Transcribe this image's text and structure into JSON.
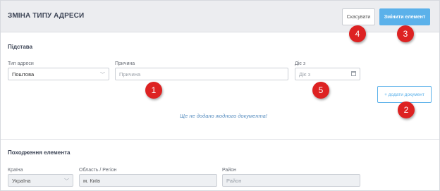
{
  "header": {
    "title": "ЗМІНА ТИПУ АДРЕСИ",
    "cancel_label": "Скасувати",
    "save_label": "Змінити елемент"
  },
  "basis": {
    "section_title": "Підстава",
    "address_type_label": "Тип адреси",
    "address_type_value": "Поштова",
    "reason_label": "Причина",
    "reason_placeholder": "Причина",
    "valid_from_label": "Діє з",
    "valid_from_placeholder": "Діє з",
    "add_document_label": "+ додати документ",
    "empty_message": "Ще не додано жодного документа!"
  },
  "origin": {
    "section_title": "Походження елемента",
    "country_label": "Країна",
    "country_value": "Україна",
    "region_label": "Область / Регіон",
    "region_value": "м. Київ",
    "district_label": "Район",
    "district_placeholder": "Район"
  },
  "callouts": [
    "1",
    "2",
    "3",
    "4",
    "5"
  ],
  "colors": {
    "accent": "#5bb1ea",
    "badge": "#dd2222",
    "header_bg": "#ecedf0"
  }
}
